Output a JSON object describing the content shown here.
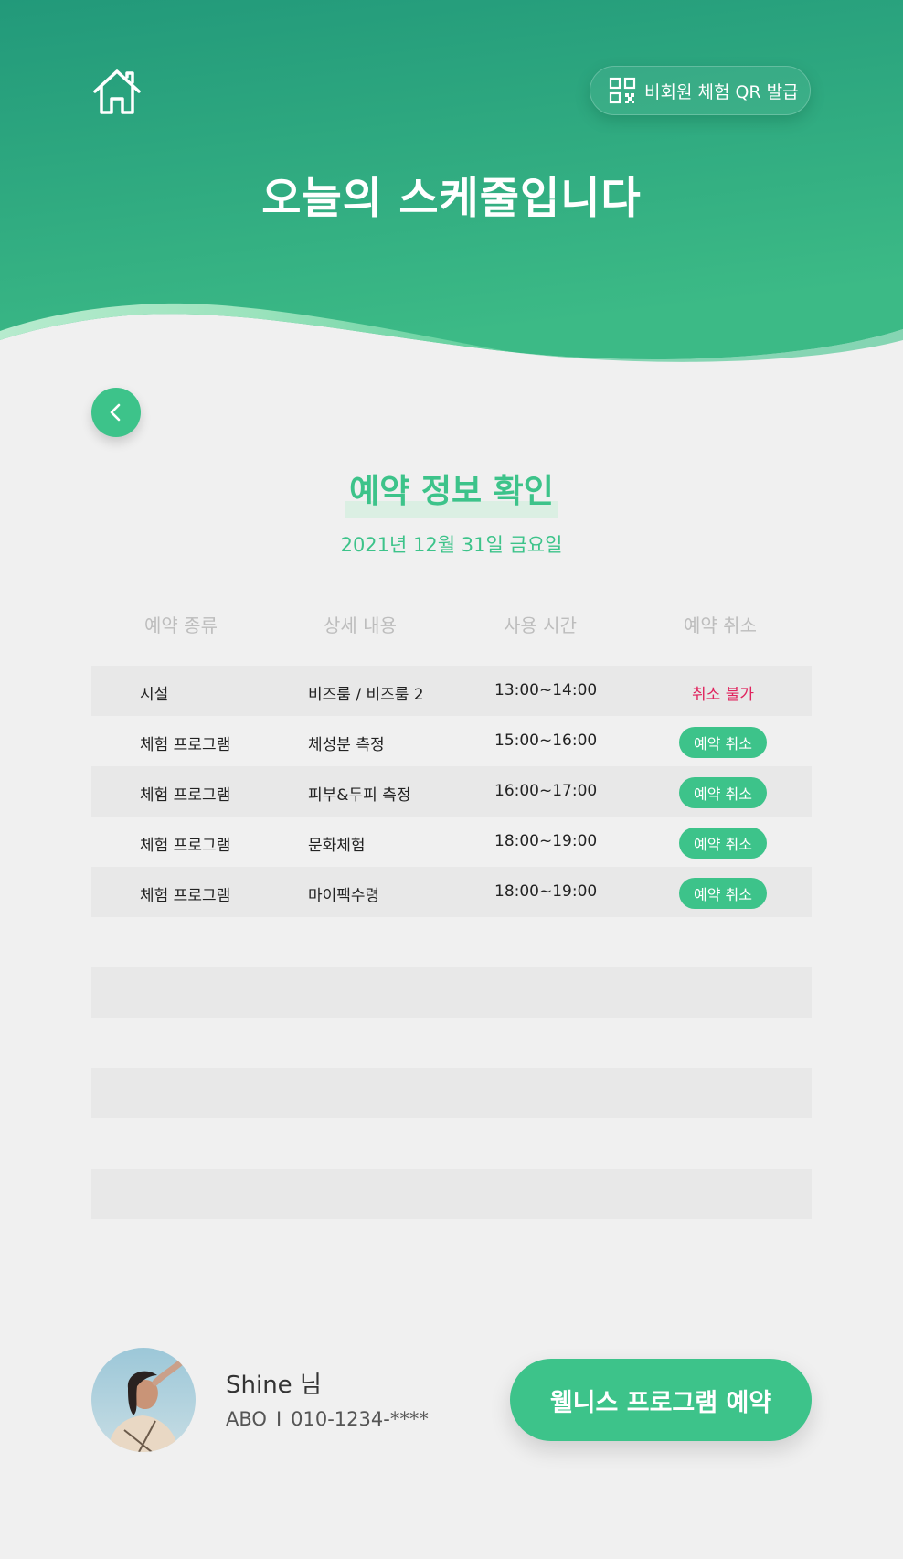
{
  "header": {
    "title": "오늘의 스케줄입니다",
    "qr_button_label": "비회원 체험 QR 발급"
  },
  "reservation": {
    "title": "예약 정보 확인",
    "date": "2021년 12월 31일 금요일",
    "columns": [
      "예약 종류",
      "상세 내용",
      "사용 시간",
      "예약 취소"
    ],
    "rows": [
      {
        "type": "시설",
        "detail": "비즈룸 / 비즈룸 2",
        "time": "13:00~14:00",
        "cancel": "취소 불가"
      },
      {
        "type": "체험 프로그램",
        "detail": "체성분 측정",
        "time": "15:00~16:00",
        "cancel": "예약 취소"
      },
      {
        "type": "체험 프로그램",
        "detail": "피부&두피 측정",
        "time": "16:00~17:00",
        "cancel": "예약 취소"
      },
      {
        "type": "체험 프로그램",
        "detail": "문화체험",
        "time": "18:00~19:00",
        "cancel": "예약 취소"
      },
      {
        "type": "체험 프로그램",
        "detail": "마이팩수령",
        "time": "18:00~19:00",
        "cancel": "예약 취소"
      }
    ]
  },
  "user": {
    "name": "Shine 님",
    "group": "ABO",
    "separator": "I",
    "phone": "010-1234-****"
  },
  "book_button_label": "웰니스 프로그램 예약",
  "colors": {
    "accent": "#3dc38a",
    "header_dark": "#1f9a77",
    "cancel_disabled": "#e0245e",
    "row_shade": "#e8e8e8"
  },
  "icons": [
    "home-icon",
    "qr-code-icon",
    "chevron-left-icon"
  ]
}
